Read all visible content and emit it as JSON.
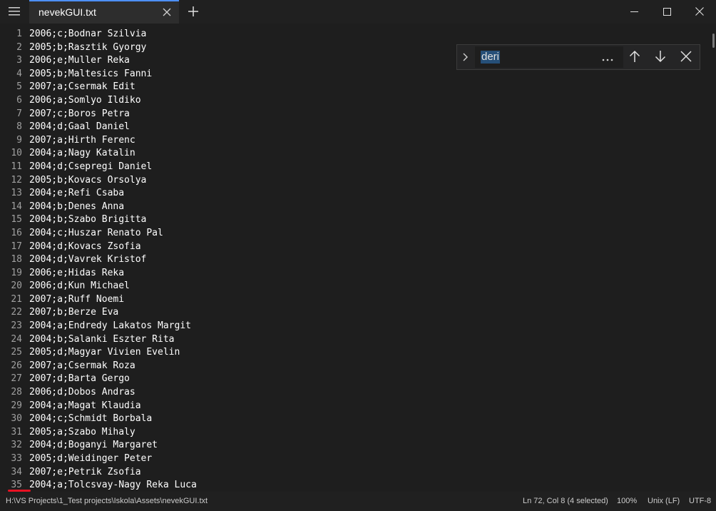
{
  "tab": {
    "title": "nevekGUI.txt"
  },
  "icons": {
    "menu": "hamburger-icon",
    "tab_close": "close-icon",
    "add_tab": "plus-icon",
    "minimize": "minimize-icon",
    "maximize": "maximize-icon",
    "close_window": "close-icon",
    "find_expand": "chevron-right-icon",
    "find_more": "more-icon",
    "find_prev": "arrow-up-icon",
    "find_next": "arrow-down-icon",
    "find_close": "close-icon"
  },
  "colors": {
    "accent": "#4d90fe",
    "selection": "#264f78",
    "annotation": "#e81123"
  },
  "editor": {
    "lines": [
      {
        "n": "1",
        "text": "2006;c;Bodnar Szilvia"
      },
      {
        "n": "2",
        "text": "2005;b;Rasztik Gyorgy"
      },
      {
        "n": "3",
        "text": "2006;e;Muller Reka"
      },
      {
        "n": "4",
        "text": "2005;b;Maltesics Fanni"
      },
      {
        "n": "5",
        "text": "2007;a;Csermak Edit"
      },
      {
        "n": "6",
        "text": "2006;a;Somlyo Ildiko"
      },
      {
        "n": "7",
        "text": "2007;c;Boros Petra"
      },
      {
        "n": "8",
        "text": "2004;d;Gaal Daniel"
      },
      {
        "n": "9",
        "text": "2007;a;Hirth Ferenc"
      },
      {
        "n": "10",
        "text": "2004;a;Nagy Katalin"
      },
      {
        "n": "11",
        "text": "2004;d;Csepregi Daniel"
      },
      {
        "n": "12",
        "text": "2005;b;Kovacs Orsolya"
      },
      {
        "n": "13",
        "text": "2004;e;Refi Csaba"
      },
      {
        "n": "14",
        "text": "2004;b;Denes Anna"
      },
      {
        "n": "15",
        "text": "2004;b;Szabo Brigitta"
      },
      {
        "n": "16",
        "text": "2004;c;Huszar Renato Pal"
      },
      {
        "n": "17",
        "text": "2004;d;Kovacs Zsofia"
      },
      {
        "n": "18",
        "text": "2004;d;Vavrek Kristof"
      },
      {
        "n": "19",
        "text": "2006;e;Hidas Reka"
      },
      {
        "n": "20",
        "text": "2006;d;Kun Michael"
      },
      {
        "n": "21",
        "text": "2007;a;Ruff Noemi"
      },
      {
        "n": "22",
        "text": "2007;b;Berze Eva"
      },
      {
        "n": "23",
        "text": "2004;a;Endredy Lakatos Margit"
      },
      {
        "n": "24",
        "text": "2004;b;Salanki Eszter Rita"
      },
      {
        "n": "25",
        "text": "2005;d;Magyar Vivien Evelin"
      },
      {
        "n": "26",
        "text": "2007;a;Csermak Roza"
      },
      {
        "n": "27",
        "text": "2007;d;Barta Gergo"
      },
      {
        "n": "28",
        "text": "2006;d;Dobos Andras"
      },
      {
        "n": "29",
        "text": "2004;a;Magat Klaudia"
      },
      {
        "n": "30",
        "text": "2004;c;Schmidt Borbala"
      },
      {
        "n": "31",
        "text": "2005;a;Szabo Mihaly"
      },
      {
        "n": "32",
        "text": "2004;d;Boganyi Margaret"
      },
      {
        "n": "33",
        "text": "2005;d;Weidinger Peter"
      },
      {
        "n": "34",
        "text": "2007;e;Petrik Zsofia"
      },
      {
        "n": "35",
        "text": "2004;a;Tolcsvay-Nagy Reka Luca"
      }
    ]
  },
  "find": {
    "query": "deri"
  },
  "status": {
    "path": "H:\\VS Projects\\1_Test projects\\Iskola\\Assets\\nevekGUI.txt",
    "position": "Ln 72, Col 8 (4 selected)",
    "zoom": "100%",
    "line_ending": "Unix (LF)",
    "encoding": "UTF-8"
  }
}
